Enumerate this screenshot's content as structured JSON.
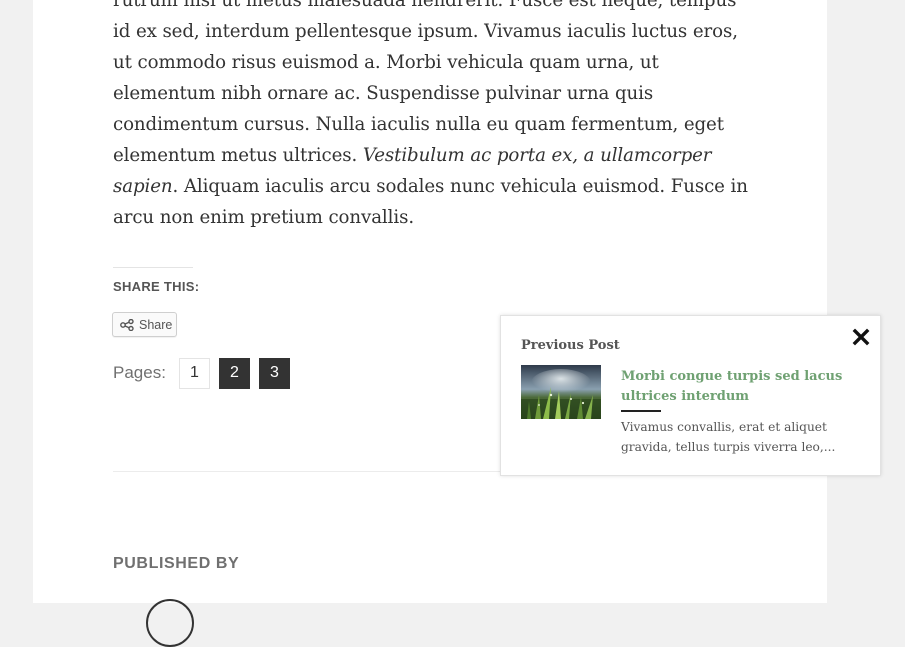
{
  "article": {
    "paragraph_part1": "rutrum nisi ut metus malesuada hendrerit. Fusce est neque, tempus id ex sed, interdum pellentesque ipsum. Vivamus iaculis luctus eros, ut commodo risus euismod a. Morbi vehicula quam urna, ut elementum nibh ornare ac. Suspendisse pulvinar urna quis condimentum cursus. Nulla iaculis nulla eu quam fermentum, eget elementum metus ultrices. ",
    "paragraph_italic": "Vestibulum ac porta ex, a ullamcorper sapien",
    "paragraph_part2": ". Aliquam iaculis arcu sodales nunc vehicula euismod. Fusce in arcu non enim pretium convallis."
  },
  "share": {
    "heading": "SHARE THIS:",
    "button_label": "Share",
    "button_icon": "share-icon"
  },
  "pagination": {
    "label": "Pages:",
    "current": "1",
    "links": [
      "2",
      "3"
    ]
  },
  "author": {
    "heading": "PUBLISHED BY"
  },
  "popup": {
    "heading": "Previous Post",
    "close_icon": "close-icon",
    "post_title": "Morbi congue turpis sed lacus ultrices interdum",
    "post_excerpt": "Vivamus convallis, erat et aliquet gravida, tellus turpis viverra leo,...",
    "title_color": "#6fa172"
  },
  "colors": {
    "page_background": "#f1f1f1",
    "article_background": "#ffffff",
    "text": "#333333",
    "accent_link": "#6fa172",
    "pagination_active_bg": "#333333"
  }
}
